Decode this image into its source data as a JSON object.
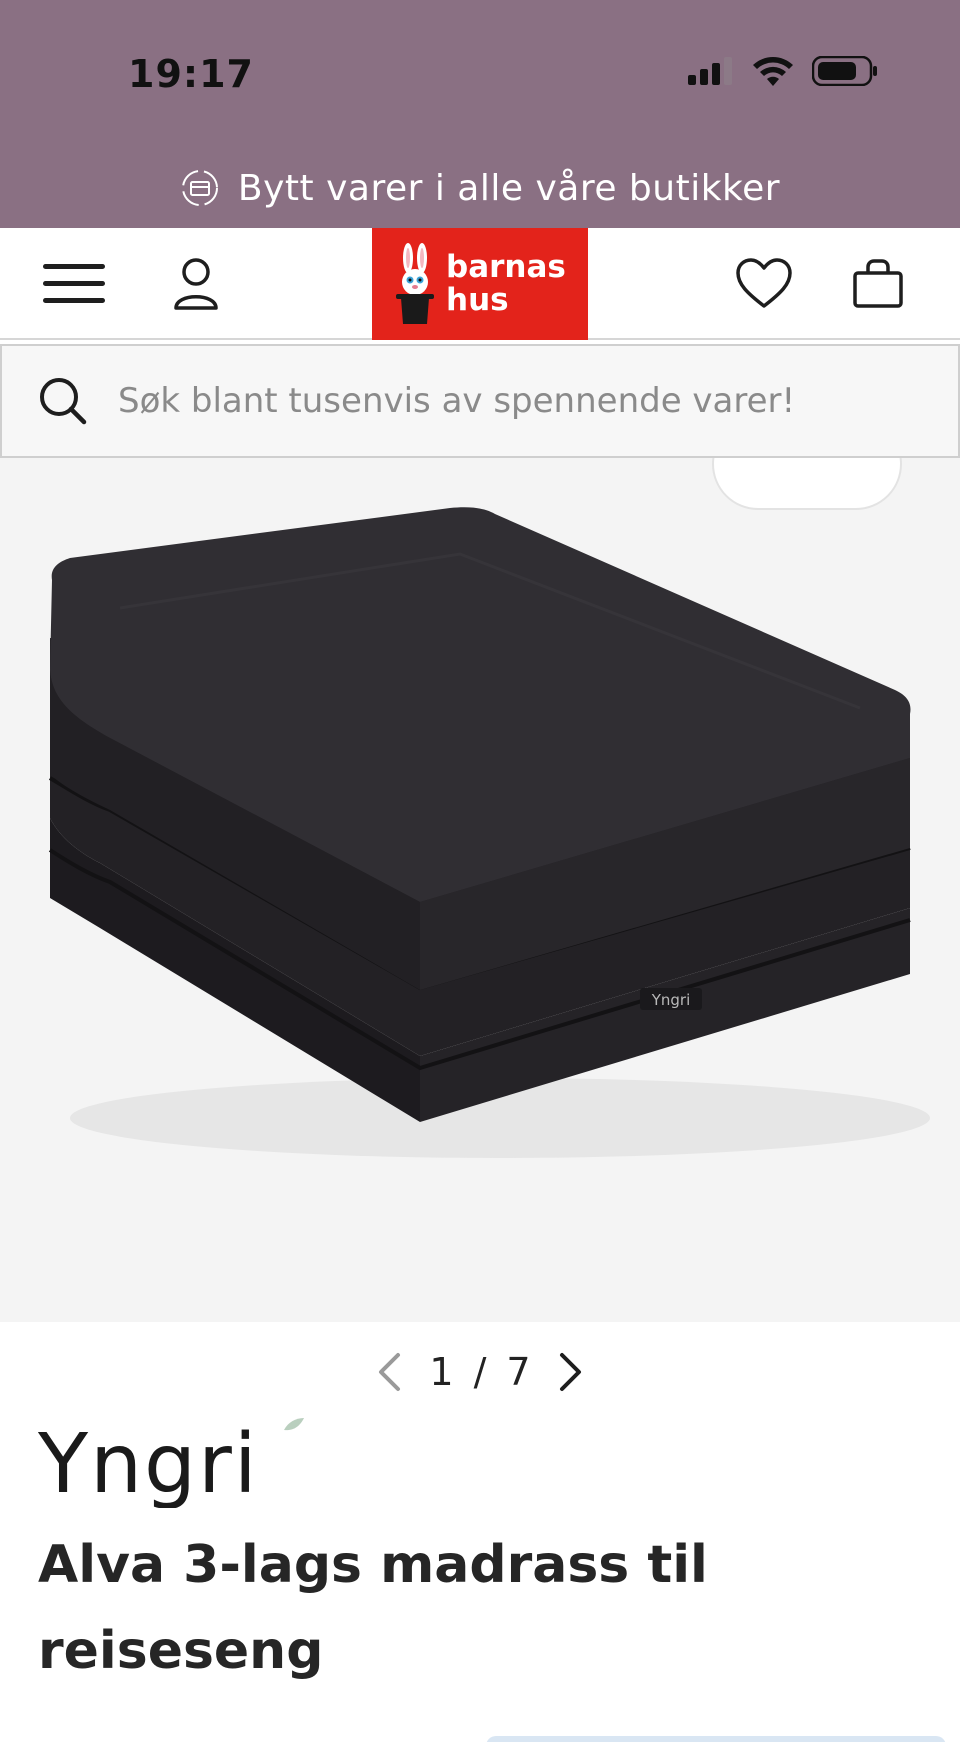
{
  "status_bar": {
    "time": "19:17"
  },
  "promo_bar": {
    "text": "Bytt varer i alle våre butikker",
    "icon": "exchange-box-icon"
  },
  "header": {
    "menu_icon": "hamburger-menu-icon",
    "account_icon": "user-icon",
    "logo": {
      "line1": "barnas",
      "line2": "hus"
    },
    "wishlist_icon": "heart-icon",
    "cart_icon": "shopping-bag-icon"
  },
  "search": {
    "placeholder": "Søk blant tusenvis av spennende varer!",
    "value": ""
  },
  "gallery": {
    "current": "1",
    "separator": "/",
    "total": "7",
    "mattress_label": "Yngri"
  },
  "product": {
    "brand": "Yngri",
    "title": "Alva 3-lags madrass til reiseseng"
  },
  "colors": {
    "top_band": "#8a7083",
    "logo_red": "#e3231b",
    "mattress": "#2a282c"
  }
}
